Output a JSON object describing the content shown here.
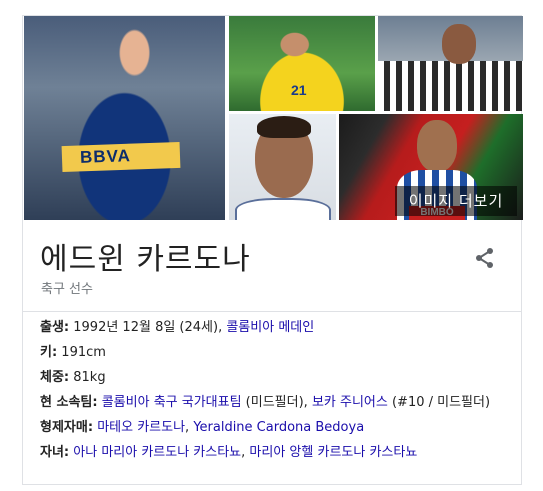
{
  "images": {
    "main_sponsor": "BBVA",
    "jersey_number": "21",
    "banner_logo": "BIMBO",
    "more_images_label": "이미지 더보기"
  },
  "header": {
    "title": "에드윈 카르도나",
    "subtitle": "축구 선수",
    "share_icon": "share-icon"
  },
  "facts": {
    "birth": {
      "key": "출생:",
      "text": " 1992년 12월 8일 (24세), ",
      "link": "콜롬비아 메데인"
    },
    "height": {
      "key": "키:",
      "text": " 191cm"
    },
    "weight": {
      "key": "체중:",
      "text": " 81kg"
    },
    "team": {
      "key": "현 소속팀:",
      "link1": "콜롬비아 축구 국가대표팀",
      "text1": " (미드필더), ",
      "link2": "보카 주니어스",
      "text2": " (#10 / 미드필더)"
    },
    "siblings": {
      "key": "형제자매:",
      "link1": "마테오 카르도나",
      "sep": ", ",
      "link2": "Yeraldine Cardona Bedoya"
    },
    "children": {
      "key": "자녀:",
      "link1": "아나 마리아 카르도나 카스타뇨",
      "sep": ", ",
      "link2": "마리아 앙헬 카르도나 카스타뇨"
    }
  },
  "colors": {
    "link": "#1a0dab",
    "subtitle": "#70757a",
    "border": "#dfe1e5"
  }
}
